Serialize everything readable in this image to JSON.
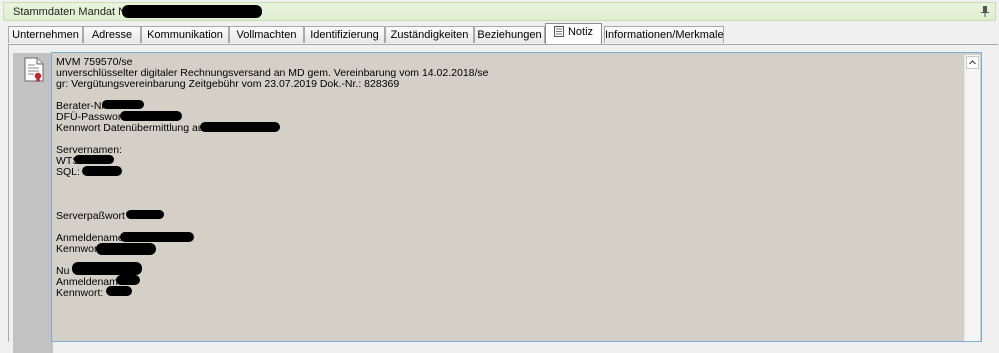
{
  "title_bar": {
    "title": "Stammdaten Mandat Nr."
  },
  "tabs": [
    {
      "label": "Unternehmen"
    },
    {
      "label": "Adresse"
    },
    {
      "label": "Kommunikation"
    },
    {
      "label": "Vollmachten"
    },
    {
      "label": "Identifizierung"
    },
    {
      "label": "Zuständigkeiten"
    },
    {
      "label": "Beziehungen"
    },
    {
      "label": "Notiz",
      "active": true
    },
    {
      "label": "Informationen/Merkmale"
    }
  ],
  "note": {
    "lines": [
      "MVM 759570/se",
      "unverschlüsselter digitaler Rechnungsversand an MD gem. Vereinbarung vom 14.02.2018/se",
      "gr: Vergütungsvereinbarung Zeitgebühr vom 23.07.2019 Dok.-Nr.: 828369",
      "",
      "Berater-Nr",
      "DFÜ-Passwort",
      "Kennwort Datenübermittlung aus",
      "",
      "Servernamen:",
      "WTS",
      "SQL:",
      "",
      "",
      "",
      "Serverpaßwort",
      "",
      "Anmeldename",
      "Kennwort",
      "",
      "Nu",
      "Anmeldename",
      "Kennwort:"
    ]
  },
  "icons": {
    "pin": "pin-icon",
    "note_document": "note-document-icon",
    "scroll_up": "scroll-up-icon"
  },
  "colors": {
    "title_bg": "#dfeed0",
    "note_bg": "#d4d0c8",
    "note_border": "#7aaed6"
  }
}
